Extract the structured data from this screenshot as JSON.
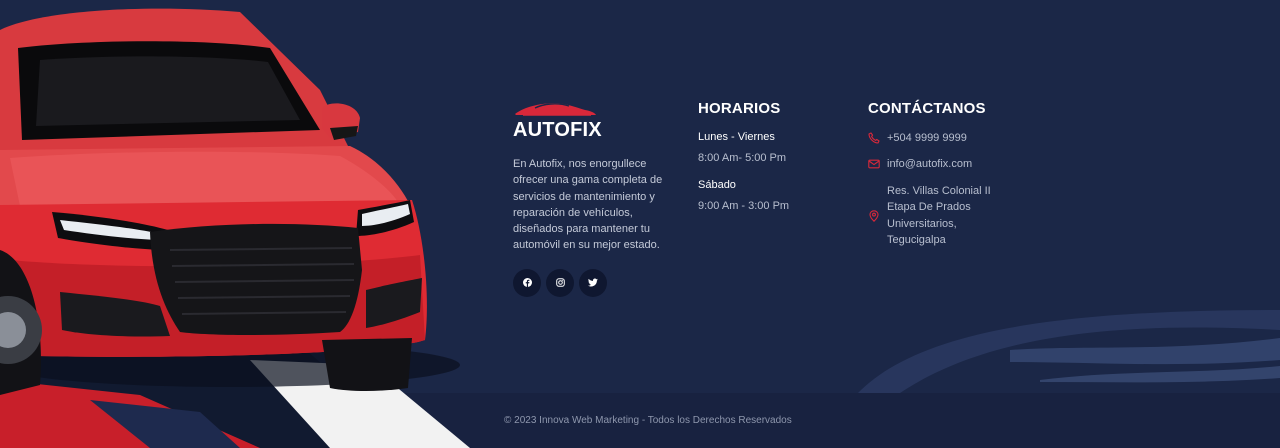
{
  "brand": {
    "name": "AUTOFIX",
    "description": "En Autofix, nos enorgullece ofrecer una gama completa de servicios de mantenimiento y reparación de vehículos, diseñados para mantener tu automóvil en su mejor estado."
  },
  "socials": [
    {
      "name": "facebook"
    },
    {
      "name": "instagram"
    },
    {
      "name": "twitter"
    }
  ],
  "hours": {
    "title": "HORARIOS",
    "weekday_label": "Lunes - Viernes",
    "weekday_hours": "8:00 Am- 5:00 Pm",
    "saturday_label": "Sábado",
    "saturday_hours": "9:00 Am - 3:00 Pm"
  },
  "contact": {
    "title": "CONTÁCTANOS",
    "phone": "+504 9999 9999",
    "email": "info@autofix.com",
    "address": "Res. Villas Colonial II Etapa De Prados Universitarios, Tegucigalpa"
  },
  "footer": {
    "copyright": "© 2023 Innova Web Marketing - Todos los Derechos Reservados"
  },
  "colors": {
    "background": "#1b2747",
    "bottom_bar": "#182240",
    "accent_red": "#d8283a",
    "heading": "#ffffff"
  },
  "icons": [
    "car-logo-icon",
    "facebook-icon",
    "instagram-icon",
    "twitter-icon",
    "phone-icon",
    "mail-icon",
    "location-pin-icon"
  ]
}
